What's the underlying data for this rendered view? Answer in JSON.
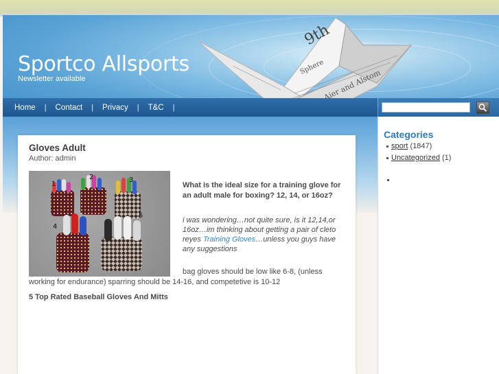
{
  "site": {
    "title": "Sportco Allsports",
    "description": "Newsletter available"
  },
  "nav": {
    "items": [
      {
        "label": "Home"
      },
      {
        "label": "Contact"
      },
      {
        "label": "Privacy"
      },
      {
        "label": "T&C"
      }
    ],
    "separator": "|"
  },
  "search": {
    "value": "",
    "button_icon": "search-icon"
  },
  "post": {
    "title": "Gloves Adult",
    "author": "Author: admin",
    "image_labels": [
      "1",
      "2",
      "3",
      "4",
      "5"
    ],
    "question_title": "What is the ideal size for a training glove for an adult male for boxing? 12, 14, or 16oz?",
    "question_body_before": "i was wondering…not quite sure, is it 12,14,or 16oz…im thinking about getting a pair of cleto reyes ",
    "question_link": "Training Gloves",
    "question_body_after": "…unless you guys have any suggestions",
    "answer": "bag gloves should be low like 6-8, (unless working for endurance) sparring should be 14-16, and competetive is 10-12",
    "related_title": "5 Top Rated Baseball Gloves And Mitts"
  },
  "sidebar": {
    "categories_title": "Categories",
    "categories": [
      {
        "name": "sport",
        "count": "(1847)"
      },
      {
        "name": "Uncategorized",
        "count": "(1)"
      }
    ]
  },
  "colors": {
    "nav_bg": "#1f578f",
    "link": "#2b8ad0",
    "category_title": "#2b7bc2"
  }
}
